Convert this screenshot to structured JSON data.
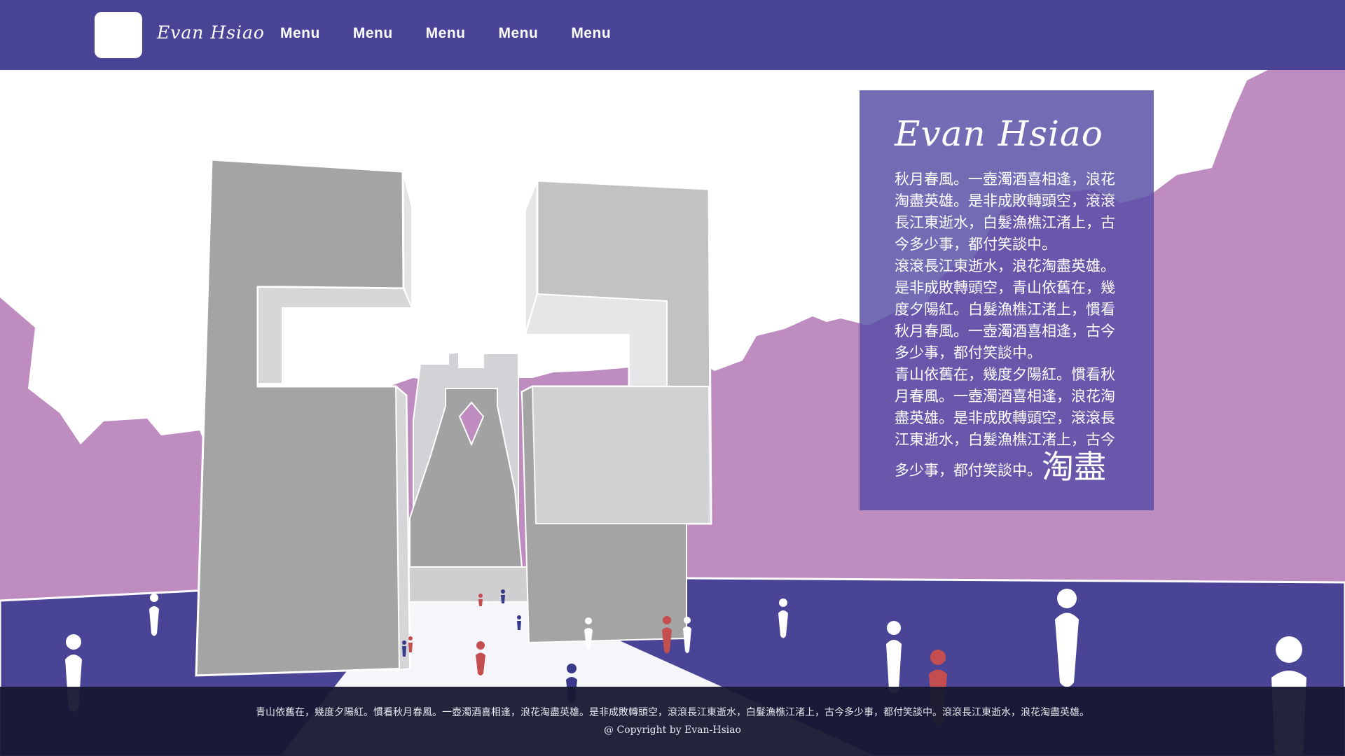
{
  "header": {
    "brand": "Evan Hsiao",
    "nav": [
      "Menu",
      "Menu",
      "Menu",
      "Menu",
      "Menu"
    ]
  },
  "panel": {
    "title": "Evan Hsiao",
    "paragraphs": [
      "秋月春風。一壺濁酒喜相逢，浪花淘盡英雄。是非成敗轉頭空，滾滾長江東逝水，白髮漁樵江渚上，古今多少事，都付笑談中。",
      "滾滾長江東逝水，浪花淘盡英雄。是非成敗轉頭空，青山依舊在，幾度夕陽紅。白髮漁樵江渚上，慣看秋月春風。一壺濁酒喜相逢，古今多少事，都付笑談中。",
      "青山依舊在，幾度夕陽紅。慣看秋月春風。一壺濁酒喜相逢，浪花淘盡英雄。是非成敗轉頭空，滾滾長江東逝水，白髮漁樵江渚上，古今"
    ],
    "last_line": "多少事，都付笑談中。",
    "big_text": "淘盡"
  },
  "footer": {
    "text": "青山依舊在，幾度夕陽紅。慣看秋月春風。一壺濁酒喜相逢，浪花淘盡英雄。是非成敗轉頭空，滾滾長江東逝水，白髮漁樵江渚上，古今多少事，都付笑談中。滾滾長江東逝水，浪花淘盡英雄。",
    "copyright": "@ Copyright by Evan-Hsiao"
  },
  "colors": {
    "header_bg": "#4a4497",
    "ground": "#4a4497",
    "hills": "#bf8cc0",
    "building_face": "#a4a4a4",
    "building_side": "#d6d5d8",
    "person_red": "#c44d4f",
    "person_blue": "#3a3a8a",
    "person_white": "#ffffff"
  }
}
